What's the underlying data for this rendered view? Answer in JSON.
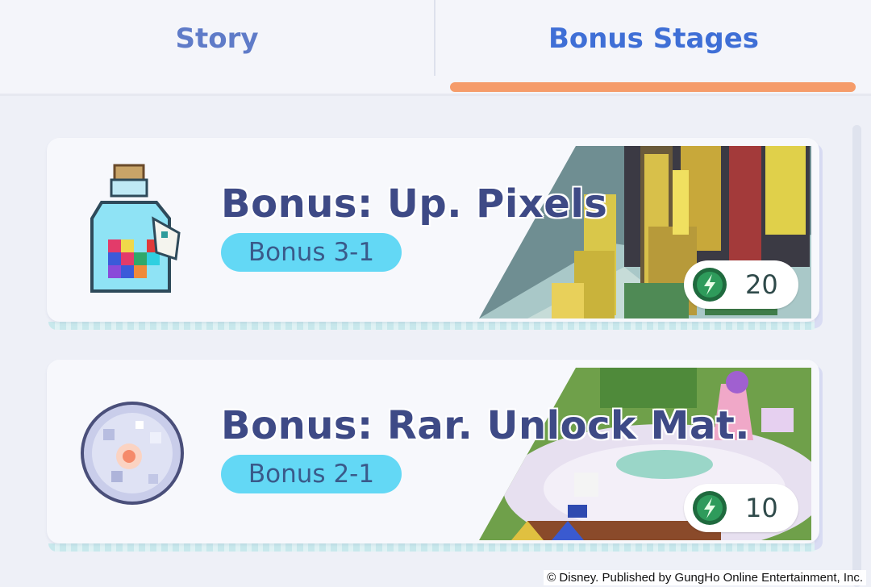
{
  "tabs": {
    "story_label": "Story",
    "bonus_label": "Bonus Stages",
    "active": "Bonus Stages"
  },
  "stages": [
    {
      "title": "Bonus: Up. Pixels",
      "badge": "Bonus 3-1",
      "cost": "20",
      "item_icon": "pixel-bottle-icon",
      "cost_icon": "energy-icon"
    },
    {
      "title": "Bonus: Rar. Unlock Mat.",
      "badge": "Bonus 2-1",
      "cost": "10",
      "item_icon": "crystal-orb-icon",
      "cost_icon": "energy-icon"
    }
  ],
  "footer": {
    "copyright": "© Disney.  Published by GungHo Online Entertainment, Inc."
  },
  "colors": {
    "active_tab": "#3f6fd6",
    "tab_underline": "#f59c6a",
    "badge": "#63d8f5",
    "title": "#3e4a86",
    "energy": "#2e9b5b"
  }
}
